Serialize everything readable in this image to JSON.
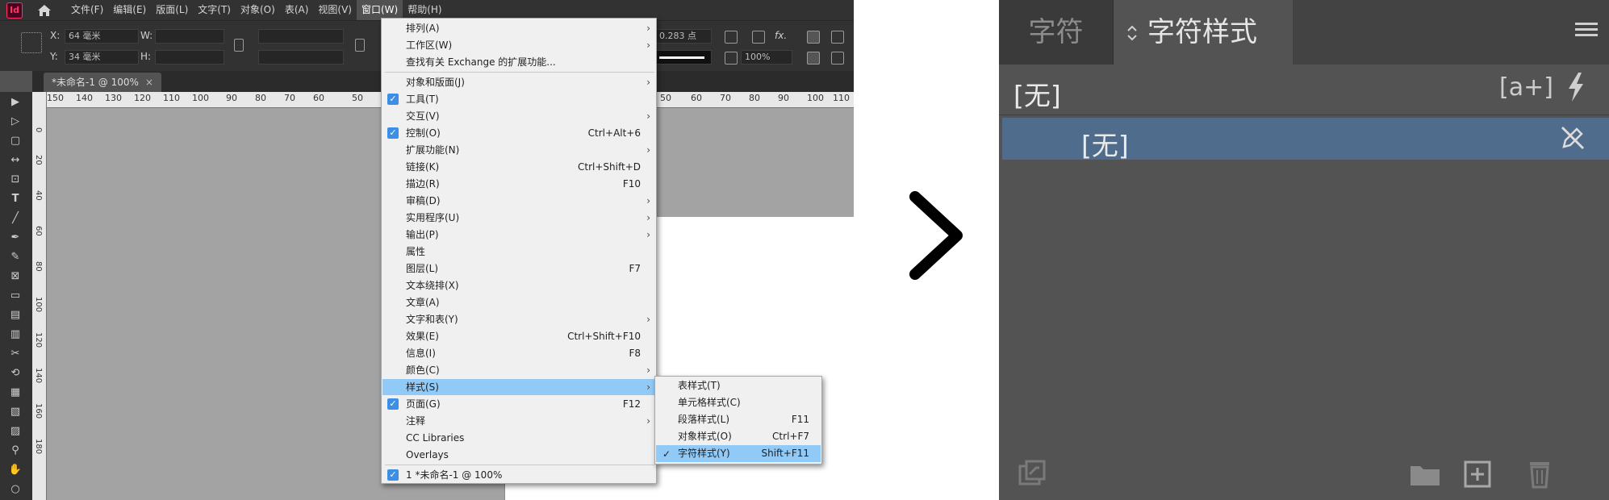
{
  "app": {
    "logo": "Id",
    "menus": [
      "文件(F)",
      "编辑(E)",
      "版面(L)",
      "文字(T)",
      "对象(O)",
      "表(A)",
      "视图(V)",
      "窗口(W)",
      "帮助(H)"
    ],
    "active_menu": "窗口(W)"
  },
  "control_panel": {
    "x_label": "X:",
    "x_value": "64 毫米",
    "y_label": "Y:",
    "y_value": "34 毫米",
    "w_label": "W:",
    "h_label": "H:",
    "stroke_value": "0.283 点",
    "zoom_value": "100%"
  },
  "document_tab": {
    "title": "*未命名-1 @ 100%",
    "close": "×"
  },
  "ruler": {
    "h_ticks": [
      "150",
      "140",
      "130",
      "120",
      "110",
      "100",
      "90",
      "80",
      "70",
      "60",
      "50",
      "50",
      "60",
      "70",
      "80",
      "90",
      "100",
      "110"
    ],
    "v_ticks": [
      "0",
      "20",
      "40",
      "60",
      "80",
      "100",
      "120",
      "140",
      "160",
      "180"
    ]
  },
  "window_menu": {
    "items": [
      {
        "label": "排列(A)",
        "shortcut": "",
        "submenu": true,
        "checked": false
      },
      {
        "label": "工作区(W)",
        "shortcut": "",
        "submenu": true,
        "checked": false
      },
      {
        "label": "查找有关 Exchange 的扩展功能...",
        "shortcut": "",
        "submenu": false,
        "checked": false
      },
      {
        "label": "对象和版面(J)",
        "shortcut": "",
        "submenu": true,
        "checked": false
      },
      {
        "label": "工具(T)",
        "shortcut": "",
        "submenu": false,
        "checked": true
      },
      {
        "label": "交互(V)",
        "shortcut": "",
        "submenu": true,
        "checked": false
      },
      {
        "label": "控制(O)",
        "shortcut": "Ctrl+Alt+6",
        "submenu": false,
        "checked": true
      },
      {
        "label": "扩展功能(N)",
        "shortcut": "",
        "submenu": true,
        "checked": false
      },
      {
        "label": "链接(K)",
        "shortcut": "Ctrl+Shift+D",
        "submenu": false,
        "checked": false
      },
      {
        "label": "描边(R)",
        "shortcut": "F10",
        "submenu": false,
        "checked": false
      },
      {
        "label": "审稿(D)",
        "shortcut": "",
        "submenu": true,
        "checked": false
      },
      {
        "label": "实用程序(U)",
        "shortcut": "",
        "submenu": true,
        "checked": false
      },
      {
        "label": "输出(P)",
        "shortcut": "",
        "submenu": true,
        "checked": false
      },
      {
        "label": "属性",
        "shortcut": "",
        "submenu": false,
        "checked": false
      },
      {
        "label": "图层(L)",
        "shortcut": "F7",
        "submenu": false,
        "checked": false
      },
      {
        "label": "文本绕排(X)",
        "shortcut": "",
        "submenu": false,
        "checked": false
      },
      {
        "label": "文章(A)",
        "shortcut": "",
        "submenu": false,
        "checked": false
      },
      {
        "label": "文字和表(Y)",
        "shortcut": "",
        "submenu": true,
        "checked": false
      },
      {
        "label": "效果(E)",
        "shortcut": "Ctrl+Shift+F10",
        "submenu": false,
        "checked": false
      },
      {
        "label": "信息(I)",
        "shortcut": "F8",
        "submenu": false,
        "checked": false
      },
      {
        "label": "颜色(C)",
        "shortcut": "",
        "submenu": true,
        "checked": false
      },
      {
        "label": "样式(S)",
        "shortcut": "",
        "submenu": true,
        "checked": false,
        "highlighted": true
      },
      {
        "label": "页面(G)",
        "shortcut": "F12",
        "submenu": false,
        "checked": true
      },
      {
        "label": "注释",
        "shortcut": "",
        "submenu": true,
        "checked": false
      },
      {
        "label": "CC Libraries",
        "shortcut": "",
        "submenu": false,
        "checked": false
      },
      {
        "label": "Overlays",
        "shortcut": "",
        "submenu": false,
        "checked": false
      },
      {
        "label": "1 *未命名-1 @ 100%",
        "shortcut": "",
        "submenu": false,
        "checked": true
      }
    ],
    "checkmark": "✓",
    "arrow": "›"
  },
  "styles_submenu": {
    "items": [
      {
        "label": "表样式(T)",
        "shortcut": "",
        "checked": false
      },
      {
        "label": "单元格样式(C)",
        "shortcut": "",
        "checked": false
      },
      {
        "label": "段落样式(L)",
        "shortcut": "F11",
        "checked": false
      },
      {
        "label": "对象样式(O)",
        "shortcut": "Ctrl+F7",
        "checked": false
      },
      {
        "label": "字符样式(Y)",
        "shortcut": "Shift+F11",
        "checked": true,
        "highlighted": true
      }
    ]
  },
  "char_styles_panel": {
    "tab_character": "字符",
    "tab_character_styles": "字符样式",
    "current_style": "[无]",
    "new_override_label": "[a+]",
    "list": [
      {
        "label": "[无]",
        "selected": true
      }
    ],
    "colors": {
      "selected_row": "#4f6c8d",
      "panel_bg": "#535353"
    }
  }
}
